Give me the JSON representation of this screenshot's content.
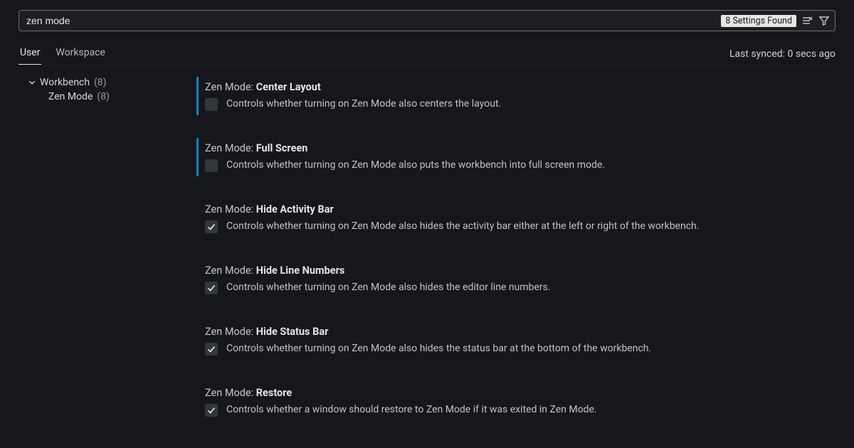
{
  "search": {
    "value": "zen mode",
    "found_badge": "8 Settings Found"
  },
  "tabs": {
    "user": "User",
    "workspace": "Workspace"
  },
  "synced": "Last synced: 0 secs ago",
  "tree": {
    "parent_label": "Workbench",
    "parent_count": "(8)",
    "child_label": "Zen Mode",
    "child_count": "(8)"
  },
  "settings": [
    {
      "prefix": "Zen Mode: ",
      "name": "Center Layout",
      "desc": "Controls whether turning on Zen Mode also centers the layout.",
      "checked": false,
      "modified": true
    },
    {
      "prefix": "Zen Mode: ",
      "name": "Full Screen",
      "desc": "Controls whether turning on Zen Mode also puts the workbench into full screen mode.",
      "checked": false,
      "modified": true
    },
    {
      "prefix": "Zen Mode: ",
      "name": "Hide Activity Bar",
      "desc": "Controls whether turning on Zen Mode also hides the activity bar either at the left or right of the workbench.",
      "checked": true,
      "modified": false
    },
    {
      "prefix": "Zen Mode: ",
      "name": "Hide Line Numbers",
      "desc": "Controls whether turning on Zen Mode also hides the editor line numbers.",
      "checked": true,
      "modified": false
    },
    {
      "prefix": "Zen Mode: ",
      "name": "Hide Status Bar",
      "desc": "Controls whether turning on Zen Mode also hides the status bar at the bottom of the workbench.",
      "checked": true,
      "modified": false
    },
    {
      "prefix": "Zen Mode: ",
      "name": "Restore",
      "desc": "Controls whether a window should restore to Zen Mode if it was exited in Zen Mode.",
      "checked": true,
      "modified": false
    }
  ]
}
